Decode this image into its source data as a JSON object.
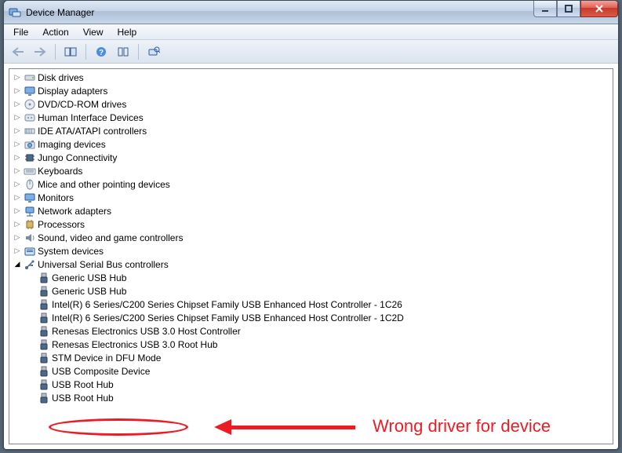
{
  "window": {
    "title": "Device Manager"
  },
  "menu": {
    "file": "File",
    "action": "Action",
    "view": "View",
    "help": "Help"
  },
  "categories": [
    {
      "id": "disk-drives",
      "label": "Disk drives",
      "icon": "disk"
    },
    {
      "id": "display-adapters",
      "label": "Display adapters",
      "icon": "monitor"
    },
    {
      "id": "dvd-cdrom",
      "label": "DVD/CD-ROM drives",
      "icon": "optical"
    },
    {
      "id": "hid",
      "label": "Human Interface Devices",
      "icon": "hid"
    },
    {
      "id": "ide-atapi",
      "label": "IDE ATA/ATAPI controllers",
      "icon": "ide"
    },
    {
      "id": "imaging",
      "label": "Imaging devices",
      "icon": "camera"
    },
    {
      "id": "jungo",
      "label": "Jungo Connectivity",
      "icon": "chip"
    },
    {
      "id": "keyboards",
      "label": "Keyboards",
      "icon": "keyboard"
    },
    {
      "id": "mice",
      "label": "Mice and other pointing devices",
      "icon": "mouse"
    },
    {
      "id": "monitors",
      "label": "Monitors",
      "icon": "monitor"
    },
    {
      "id": "network",
      "label": "Network adapters",
      "icon": "network"
    },
    {
      "id": "processors",
      "label": "Processors",
      "icon": "cpu"
    },
    {
      "id": "sound",
      "label": "Sound, video and game controllers",
      "icon": "sound"
    },
    {
      "id": "system",
      "label": "System devices",
      "icon": "system"
    }
  ],
  "usb": {
    "label": "Universal Serial Bus controllers",
    "children": [
      "Generic USB Hub",
      "Generic USB Hub",
      "Intel(R) 6 Series/C200 Series Chipset Family USB Enhanced Host Controller - 1C26",
      "Intel(R) 6 Series/C200 Series Chipset Family USB Enhanced Host Controller - 1C2D",
      "Renesas Electronics USB 3.0 Host Controller",
      "Renesas Electronics USB 3.0 Root Hub",
      "STM Device in DFU Mode",
      "USB Composite Device",
      "USB Root Hub",
      "USB Root Hub"
    ]
  },
  "annotation": {
    "text": "Wrong driver for device"
  }
}
